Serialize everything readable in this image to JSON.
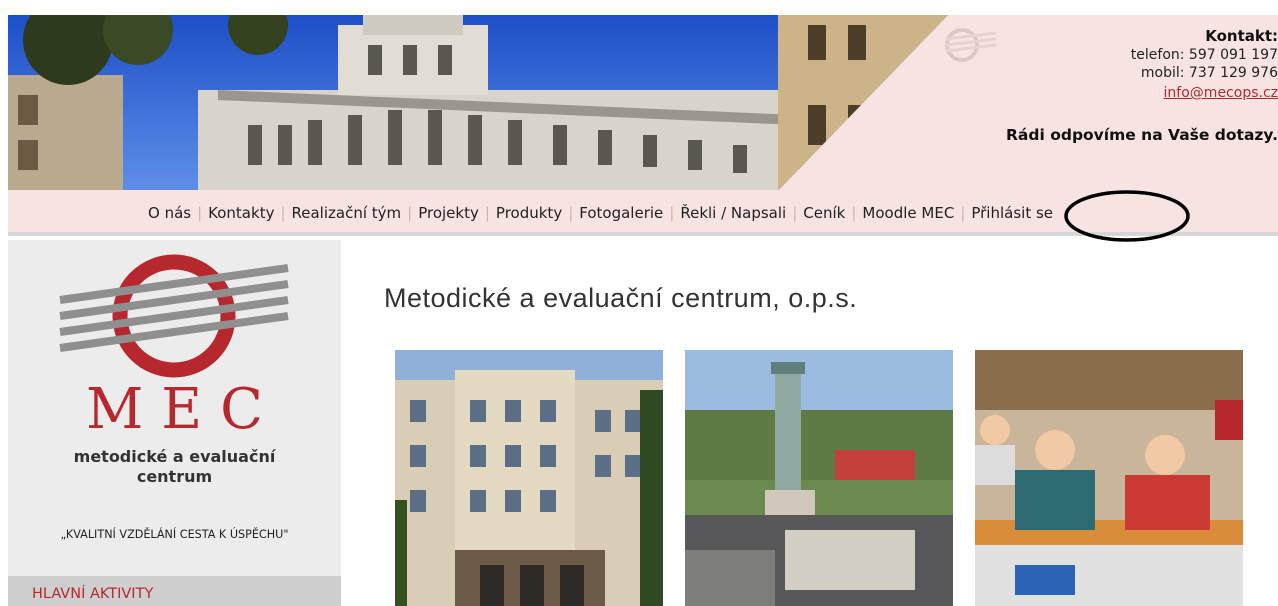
{
  "header": {
    "contact_title": "Kontakt:",
    "phone": "telefon: 597 091 197",
    "mobile": "mobil: 737 129 976",
    "email": "info@mecops.cz",
    "tagline": "Rádi odpovíme na Vaše dotazy."
  },
  "nav": {
    "items": [
      {
        "label": "O nás"
      },
      {
        "label": "Kontakty"
      },
      {
        "label": "Realizační tým"
      },
      {
        "label": "Projekty"
      },
      {
        "label": "Produkty"
      },
      {
        "label": "Fotogalerie"
      },
      {
        "label": "Řekli / Napsali"
      },
      {
        "label": "Ceník"
      },
      {
        "label": "Moodle MEC"
      },
      {
        "label": "Přihlásit se"
      }
    ]
  },
  "sidebar": {
    "logo_letters": "MEC",
    "logo_name_line1": "metodické a evaluační",
    "logo_name_line2": "centrum",
    "motto": "„KVALITNÍ VZDĚLÁNÍ CESTA K ÚSPĚCHU\"",
    "activities_heading": "HLAVNÍ AKTIVITY"
  },
  "main": {
    "title": "Metodické a evaluační centrum, o.p.s."
  },
  "colors": {
    "brand_red": "#b7282e",
    "header_pink": "#f7e3e2",
    "sidebar_gray": "#ececec"
  }
}
